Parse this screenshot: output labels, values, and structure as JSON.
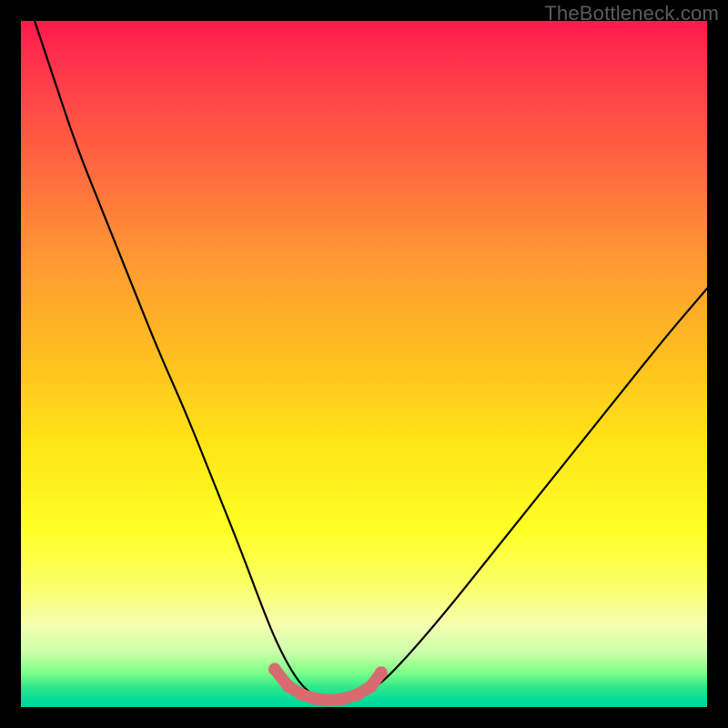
{
  "attribution": "TheBottleneck.com",
  "colors": {
    "background": "#000000",
    "curve": "#000000",
    "bottom_marker": "#d86b6f",
    "gradient_stops": [
      "#ff1a4d",
      "#ff3b4a",
      "#ff6b3f",
      "#ff9933",
      "#ffc21f",
      "#ffe617",
      "#ffff26",
      "#fbff66",
      "#f5ffb0",
      "#ccffaa",
      "#7dff88",
      "#33e88a",
      "#00dd99",
      "#00cfa0"
    ]
  },
  "chart_data": {
    "type": "line",
    "title": "",
    "xlabel": "",
    "ylabel": "",
    "xlim": [
      0,
      100
    ],
    "ylim": [
      0,
      100
    ],
    "annotations": [
      "TheBottleneck.com"
    ],
    "series": [
      {
        "name": "bottleneck-curve",
        "x": [
          2,
          5,
          8,
          12,
          16,
          20,
          24,
          28,
          32,
          35,
          37,
          39,
          41,
          43,
          45,
          47,
          49,
          52,
          56,
          62,
          70,
          78,
          86,
          94,
          100
        ],
        "y": [
          100,
          91,
          82,
          72,
          62,
          52,
          43,
          33,
          23,
          15,
          10,
          6,
          3,
          1.5,
          1,
          1,
          1.5,
          3,
          7,
          14,
          24,
          34,
          44,
          54,
          61
        ]
      }
    ],
    "bottom_highlight": {
      "name": "optimal-range",
      "x": [
        37,
        39,
        41,
        43,
        45,
        47,
        49,
        51,
        52.5
      ],
      "y": [
        5.5,
        3,
        1.8,
        1.2,
        1,
        1.2,
        1.8,
        3,
        5
      ]
    }
  }
}
